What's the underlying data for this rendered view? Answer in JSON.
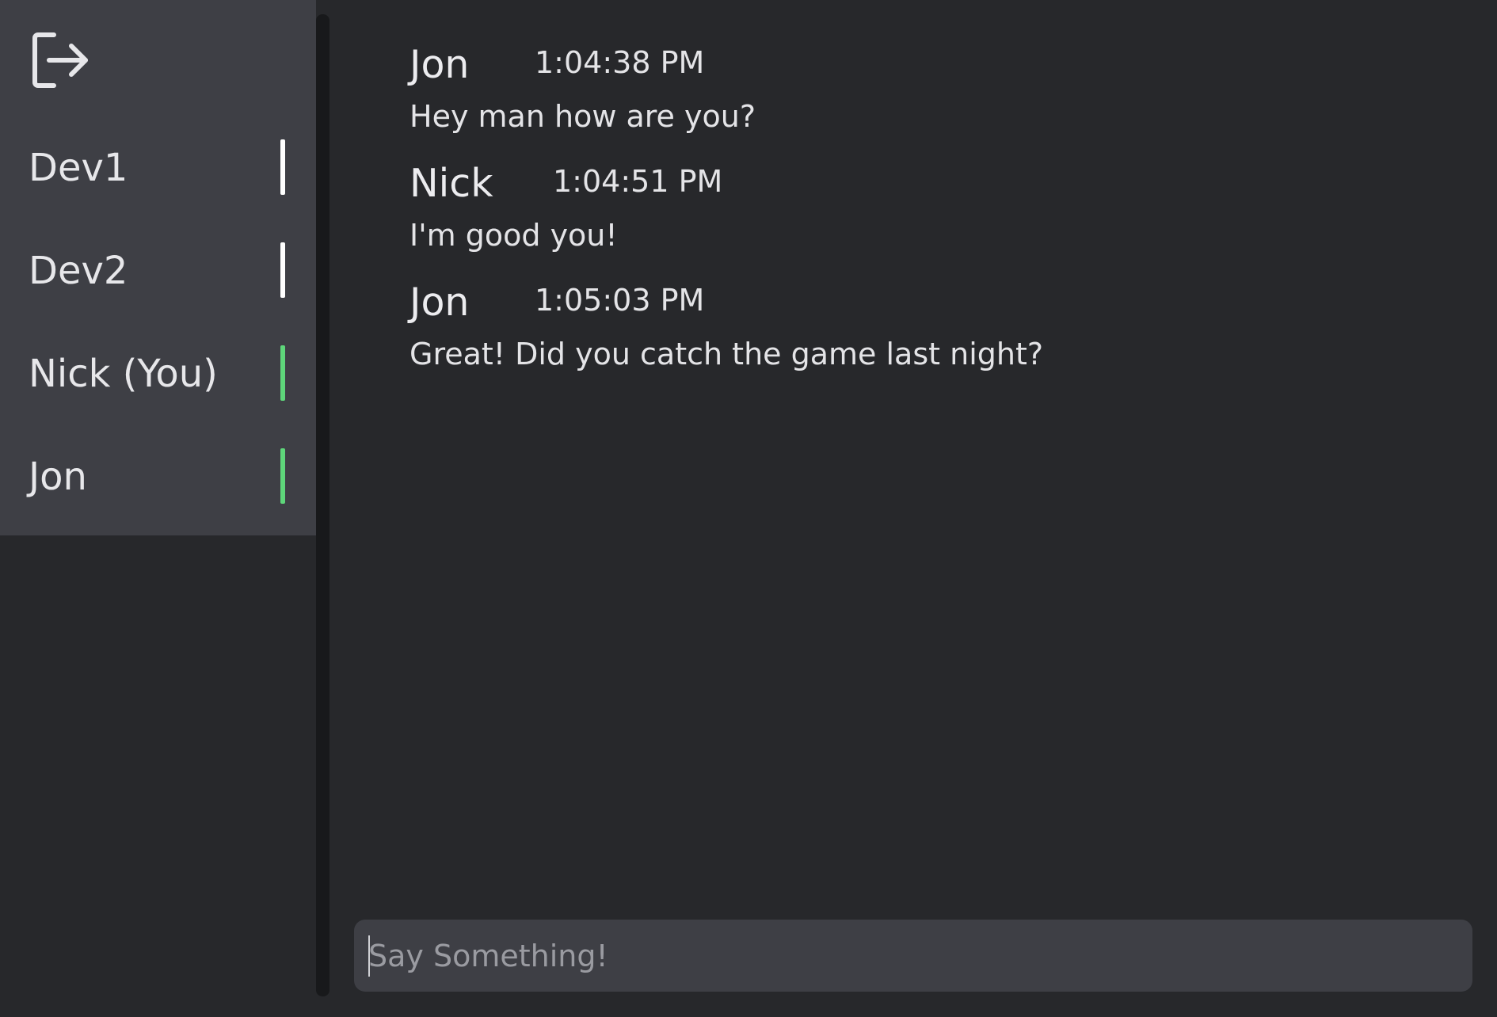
{
  "sidebar": {
    "logout_icon": "logout-icon",
    "users": [
      {
        "name": "Dev1",
        "status_color": "#ffffff"
      },
      {
        "name": "Dev2",
        "status_color": "#ffffff"
      },
      {
        "name": "Nick (You)",
        "status_color": "#5ed67a"
      },
      {
        "name": "Jon",
        "status_color": "#5ed67a"
      }
    ]
  },
  "messages": [
    {
      "author": "Jon",
      "time": "1:04:38 PM",
      "text": "Hey man how are you?"
    },
    {
      "author": "Nick",
      "time": "1:04:51 PM",
      "text": "I'm good you!"
    },
    {
      "author": "Jon",
      "time": "1:05:03 PM",
      "text": "Great! Did you catch the game last night?"
    }
  ],
  "composer": {
    "placeholder": "Say Something!",
    "value": ""
  },
  "colors": {
    "background": "#27282b",
    "panel": "#3e3f45",
    "online": "#5ed67a",
    "offline": "#ffffff"
  }
}
